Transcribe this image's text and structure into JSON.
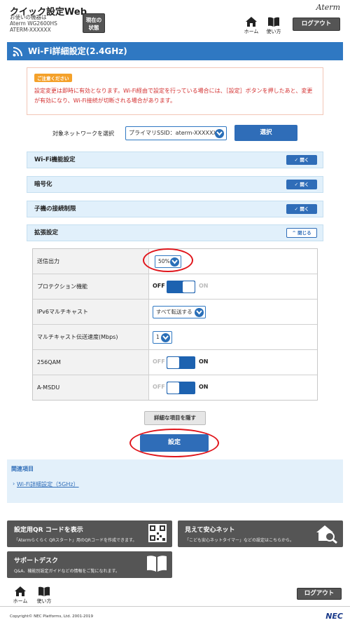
{
  "header": {
    "app_title": "クイック設定Web",
    "device_prefix": "お使いの機器は",
    "device_model": "Aterm WG2600HS",
    "device_ssid": "ATERM-XXXXXX",
    "status_button": [
      "現在の",
      "状態"
    ],
    "brand": "Aterm",
    "home_label": "ホーム",
    "howto_label": "使い方",
    "logout_label": "ログアウト"
  },
  "page": {
    "title": "Wi-Fi詳細設定(2.4GHz)"
  },
  "notice": {
    "badge": "ご注意ください",
    "text": "設定変更は即時に有効となります。Wi-Fi経由で設定を行っている場合には、［設定］ボタンを押したあと、変更が有効になり、Wi-Fi接続が切断される場合があります。"
  },
  "network_select": {
    "label": "対象ネットワークを選択",
    "value": "プライマリSSID：aterm-XXXXXX-g",
    "button": "選択"
  },
  "sections": [
    {
      "label": "Wi-Fi機能設定",
      "button": "開く"
    },
    {
      "label": "暗号化",
      "button": "開く"
    },
    {
      "label": "子機の接続制限",
      "button": "開く"
    },
    {
      "label": "拡張設定",
      "button": "閉じる"
    }
  ],
  "settings": {
    "tx_power": {
      "label": "送信出力",
      "value": "50%"
    },
    "protection": {
      "label": "プロテクション機能",
      "off": "OFF",
      "on": "ON",
      "state": "off"
    },
    "ipv6_multicast": {
      "label": "IPv6マルチキャスト",
      "value": "すべて転送する"
    },
    "multicast_rate": {
      "label": "マルチキャスト伝送速度(Mbps)",
      "value": "1"
    },
    "qam256": {
      "label": "256QAM",
      "off": "OFF",
      "on": "ON",
      "state": "on"
    },
    "amsdu": {
      "label": "A-MSDU",
      "off": "OFF",
      "on": "ON",
      "state": "on"
    }
  },
  "actions": {
    "hide_details": "詳細な項目を隠す",
    "apply": "設定"
  },
  "related": {
    "title": "関連項目",
    "link": "Wi-Fi詳細設定（5GHz）"
  },
  "tiles": [
    {
      "title": "設定用QR コードを表示",
      "sub": "「Atermらくらく QRスタート」用のQRコードを作成できます。",
      "icon": "qr-code-icon"
    },
    {
      "title": "見えて安心ネット",
      "sub": "「こども安心ネットタイマー」などの設定はこちらから。",
      "icon": "house-search-icon"
    },
    {
      "title": "サポートデスク",
      "sub": "Q&A、機能別設定ガイドなどの情報をご覧になれます。",
      "icon": "book-icon"
    }
  ],
  "footer": {
    "home_label": "ホーム",
    "howto_label": "使い方",
    "logout_label": "ログアウト",
    "copyright": "Copyright© NEC Platforms, Ltd. 2001-2019",
    "brand": "NEC"
  },
  "colors": {
    "accent": "#2f6db8",
    "warning": "#d32f2f",
    "highlight_ring": "#e0151b"
  }
}
